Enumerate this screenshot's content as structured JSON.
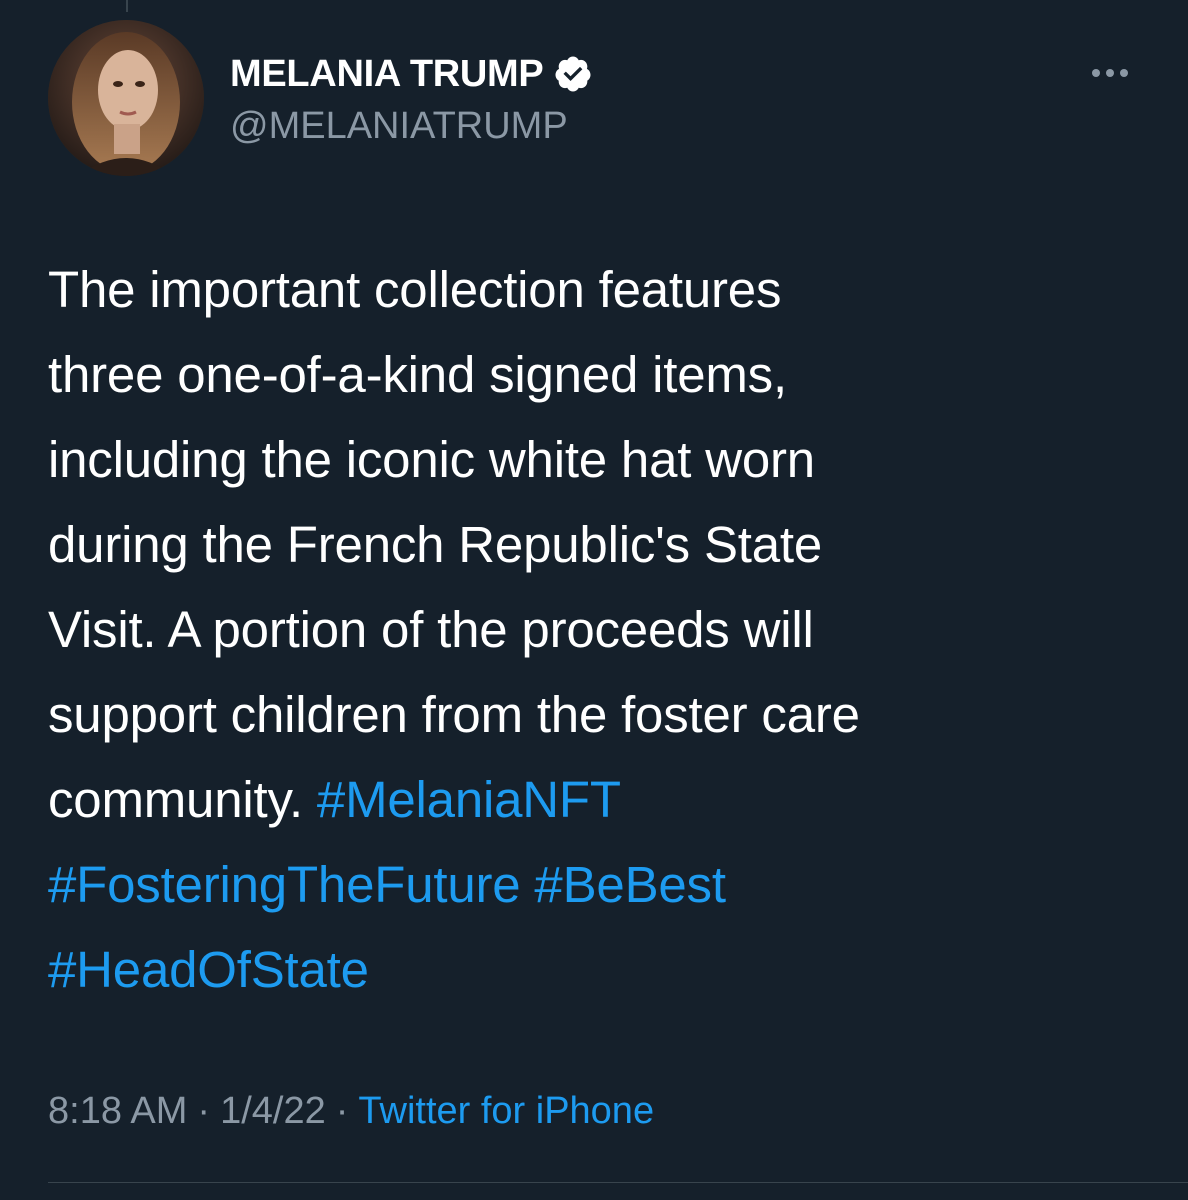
{
  "author": {
    "display_name": "MELANIA TRUMP",
    "handle": "@MELANIATRUMP",
    "verified": true
  },
  "tweet": {
    "lines": [
      [
        {
          "text": "The important collection features",
          "hashtag": false
        }
      ],
      [
        {
          "text": "three one-of-a-kind signed items,",
          "hashtag": false
        }
      ],
      [
        {
          "text": "including the iconic white hat worn",
          "hashtag": false
        }
      ],
      [
        {
          "text": "during the French Republic's State",
          "hashtag": false
        }
      ],
      [
        {
          "text": "Visit. A portion of the proceeds will",
          "hashtag": false
        }
      ],
      [
        {
          "text": "support children from the foster care",
          "hashtag": false
        }
      ],
      [
        {
          "text": "community. ",
          "hashtag": false
        },
        {
          "text": "#MelaniaNFT",
          "hashtag": true
        }
      ],
      [
        {
          "text": "#FosteringTheFuture",
          "hashtag": true
        },
        {
          "text": " ",
          "hashtag": false
        },
        {
          "text": "#BeBest",
          "hashtag": true
        }
      ],
      [
        {
          "text": "#HeadOfState",
          "hashtag": true
        }
      ]
    ]
  },
  "meta": {
    "time": "8:18 AM",
    "separator": "·",
    "date": "1/4/22",
    "source": "Twitter for iPhone"
  },
  "colors": {
    "background": "#15202b",
    "link": "#1d9bf0",
    "secondary_text": "#8b98a5",
    "verified_badge": "#ffffff"
  },
  "icons": {
    "verified": "verified-badge-icon",
    "more": "more-options-icon"
  }
}
